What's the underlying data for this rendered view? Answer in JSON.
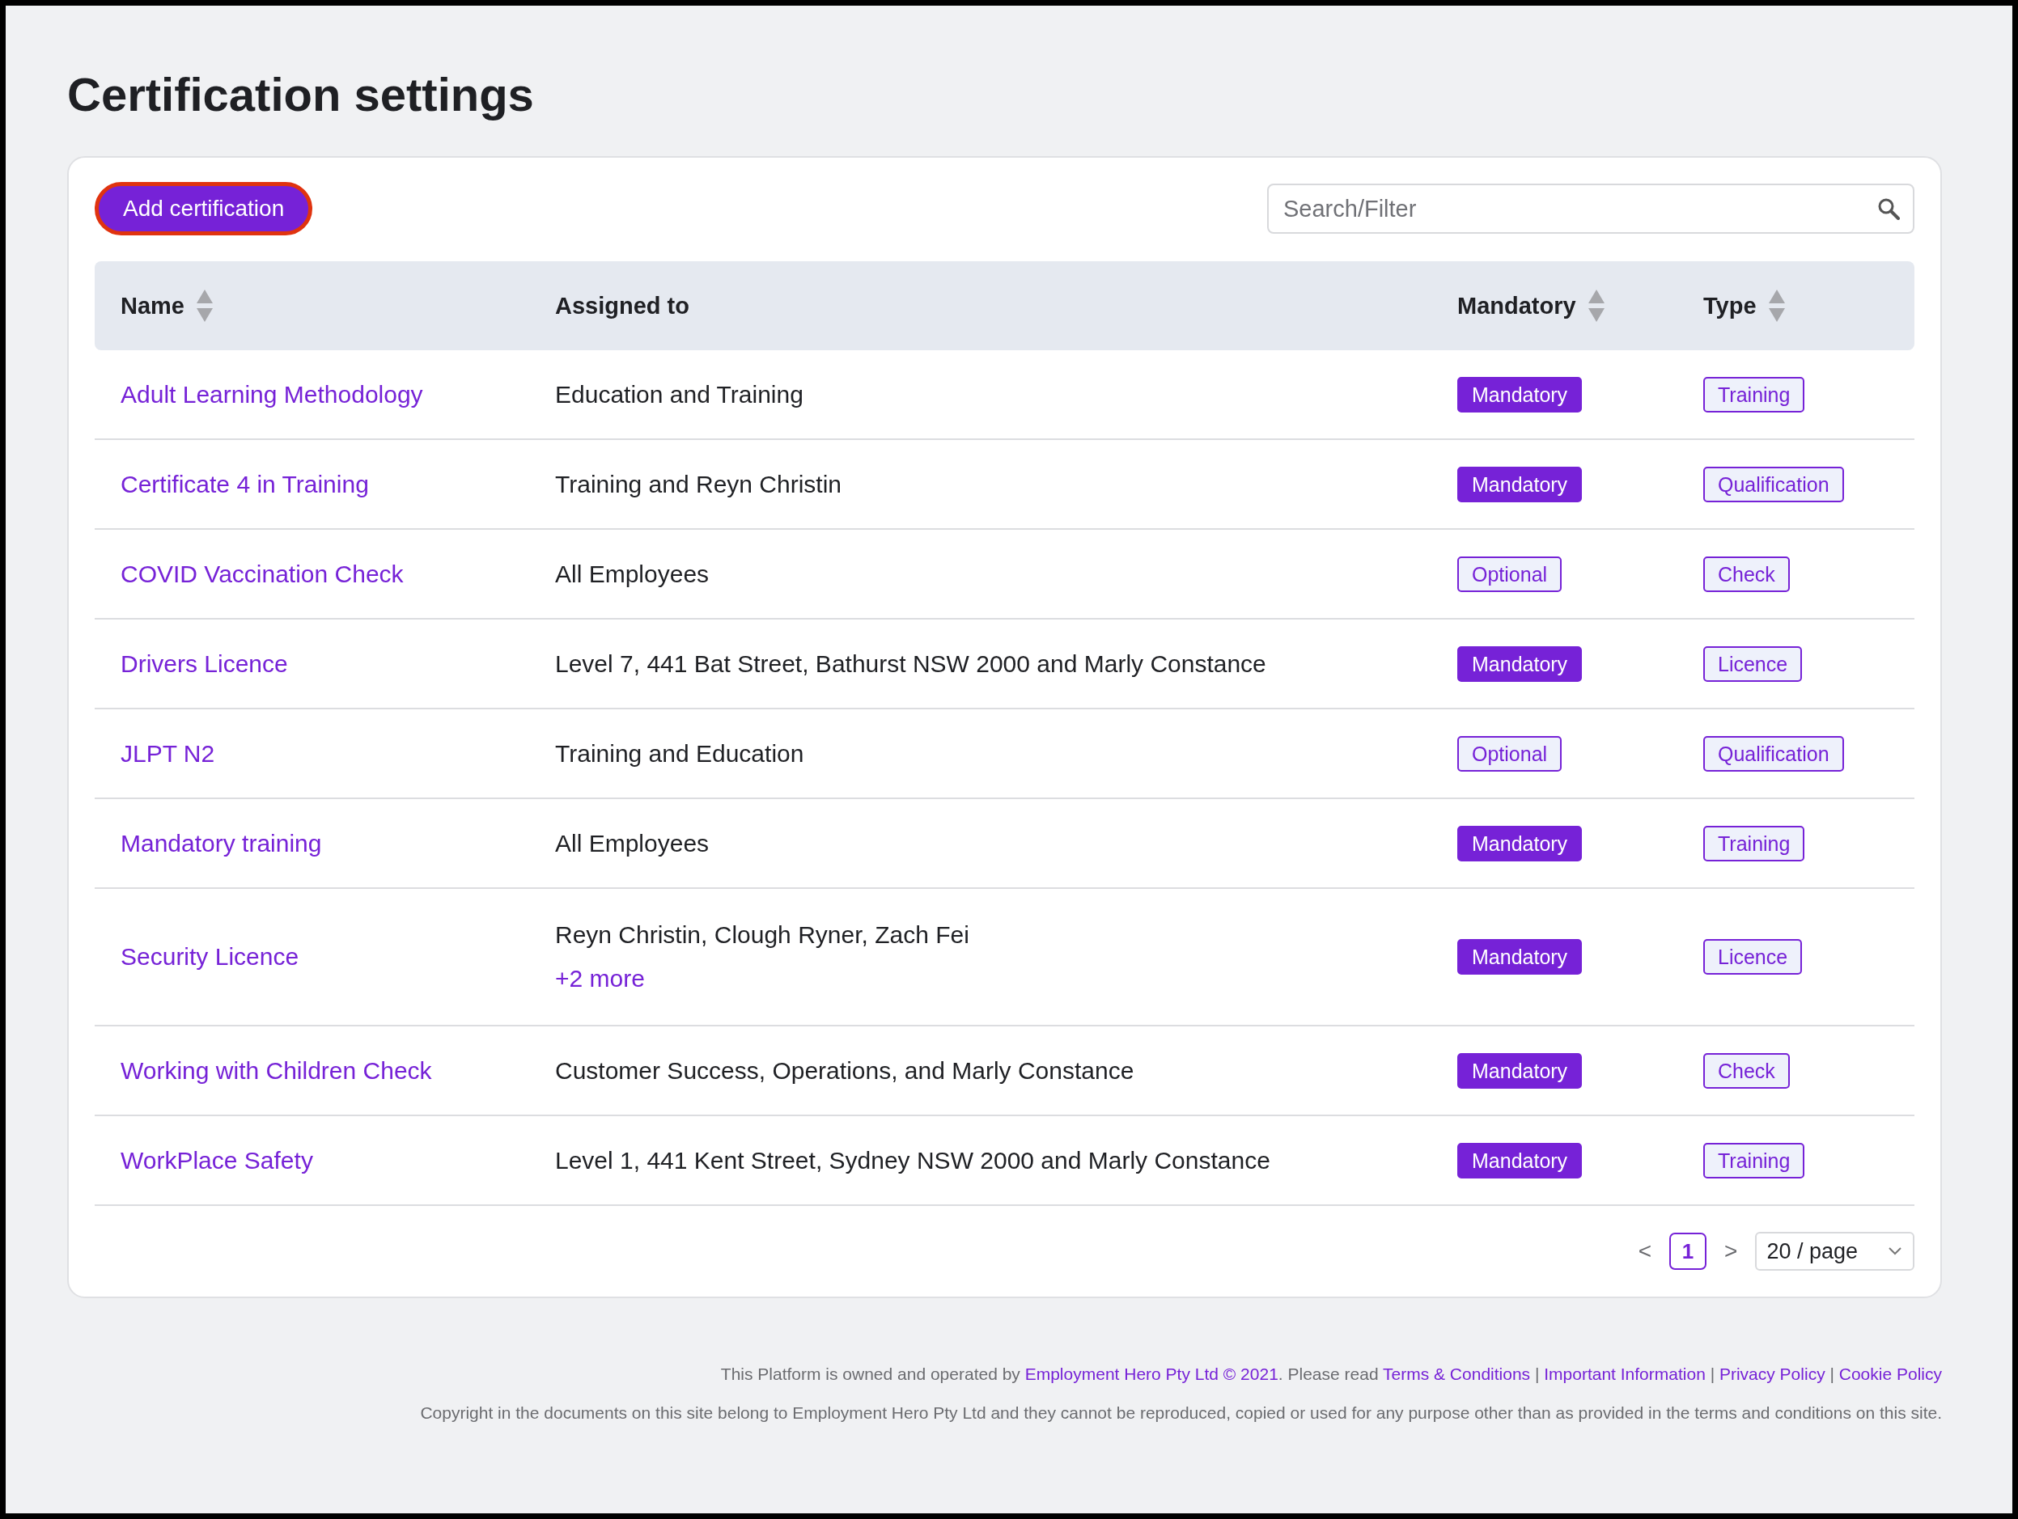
{
  "title": "Certification settings",
  "toolbar": {
    "add_button": "Add certification",
    "search": {
      "placeholder": "Search/Filter"
    }
  },
  "table": {
    "columns": [
      {
        "label": "Name",
        "sortable": true
      },
      {
        "label": "Assigned to",
        "sortable": false
      },
      {
        "label": "Mandatory",
        "sortable": true
      },
      {
        "label": "Type",
        "sortable": true
      }
    ],
    "rows": [
      {
        "name": "Adult Learning Methodology",
        "assigned": "Education and Training",
        "mandatory": {
          "label": "Mandatory",
          "kind": "filled"
        },
        "type": "Training"
      },
      {
        "name": "Certificate 4 in Training",
        "assigned": "Training and Reyn Christin",
        "mandatory": {
          "label": "Mandatory",
          "kind": "filled"
        },
        "type": "Qualification"
      },
      {
        "name": "COVID Vaccination Check",
        "assigned": "All Employees",
        "mandatory": {
          "label": "Optional",
          "kind": "outline"
        },
        "type": "Check"
      },
      {
        "name": "Drivers Licence",
        "assigned": "Level 7, 441 Bat Street, Bathurst NSW 2000 and Marly Constance",
        "mandatory": {
          "label": "Mandatory",
          "kind": "filled"
        },
        "type": "Licence"
      },
      {
        "name": "JLPT N2",
        "assigned": "Training and Education",
        "mandatory": {
          "label": "Optional",
          "kind": "outline"
        },
        "type": "Qualification"
      },
      {
        "name": "Mandatory training",
        "assigned": "All Employees",
        "mandatory": {
          "label": "Mandatory",
          "kind": "filled"
        },
        "type": "Training"
      },
      {
        "name": "Security Licence",
        "assigned": "Reyn Christin, Clough Ryner, Zach Fei",
        "more": "+2 more",
        "mandatory": {
          "label": "Mandatory",
          "kind": "filled"
        },
        "type": "Licence"
      },
      {
        "name": "Working with Children Check",
        "assigned": "Customer Success, Operations, and Marly Constance",
        "mandatory": {
          "label": "Mandatory",
          "kind": "filled"
        },
        "type": "Check"
      },
      {
        "name": "WorkPlace Safety",
        "assigned": "Level 1, 441 Kent Street, Sydney NSW 2000 and Marly Constance",
        "mandatory": {
          "label": "Mandatory",
          "kind": "filled"
        },
        "type": "Training"
      }
    ]
  },
  "pagination": {
    "prev": "<",
    "pages": [
      {
        "label": "1",
        "selected": true
      }
    ],
    "next": ">",
    "page_size": "20 / page"
  },
  "footer": {
    "line_1": [
      {
        "kind": "text",
        "text": "This Platform is owned and operated by "
      },
      {
        "kind": "link",
        "text": "Employment Hero Pty Ltd © 2021"
      },
      {
        "kind": "text",
        "text": ". Please read "
      },
      {
        "kind": "link",
        "text": "Terms & Conditions"
      },
      {
        "kind": "text",
        "text": " | "
      },
      {
        "kind": "link",
        "text": "Important Information"
      },
      {
        "kind": "text",
        "text": " | "
      },
      {
        "kind": "link",
        "text": "Privacy Policy"
      },
      {
        "kind": "text",
        "text": " | "
      },
      {
        "kind": "link",
        "text": "Cookie Policy"
      }
    ],
    "line_2": "Copyright in the documents on this site belong to Employment Hero Pty Ltd and they cannot be reproduced, copied or used for any purpose other than as provided in the terms and conditions on this site."
  }
}
